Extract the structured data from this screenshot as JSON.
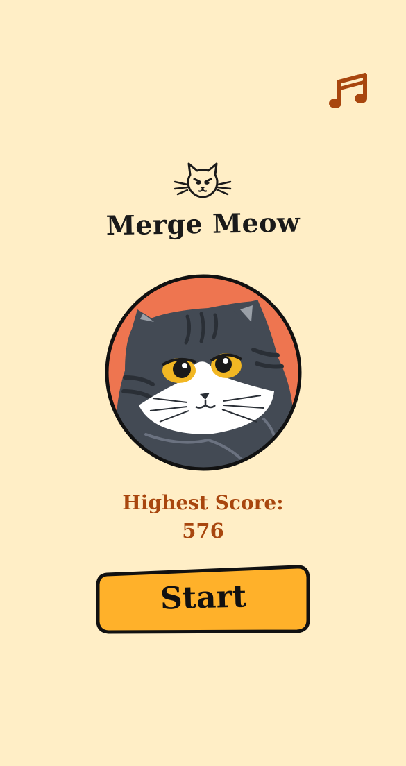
{
  "app": {
    "title": "Merge Meow"
  },
  "music": {
    "icon": "music-note-icon",
    "color": "#A8460E"
  },
  "logo": {
    "icon": "cat-face-icon"
  },
  "avatar": {
    "icon": "tabby-cat-portrait",
    "background_color": "#EE7550"
  },
  "score": {
    "label": "Highest Score:",
    "value": "576"
  },
  "start_button": {
    "label": "Start",
    "color": "#FFB12A"
  },
  "colors": {
    "background": "#FFEEC6",
    "accent": "#A8460E",
    "text": "#1a1a1a"
  }
}
